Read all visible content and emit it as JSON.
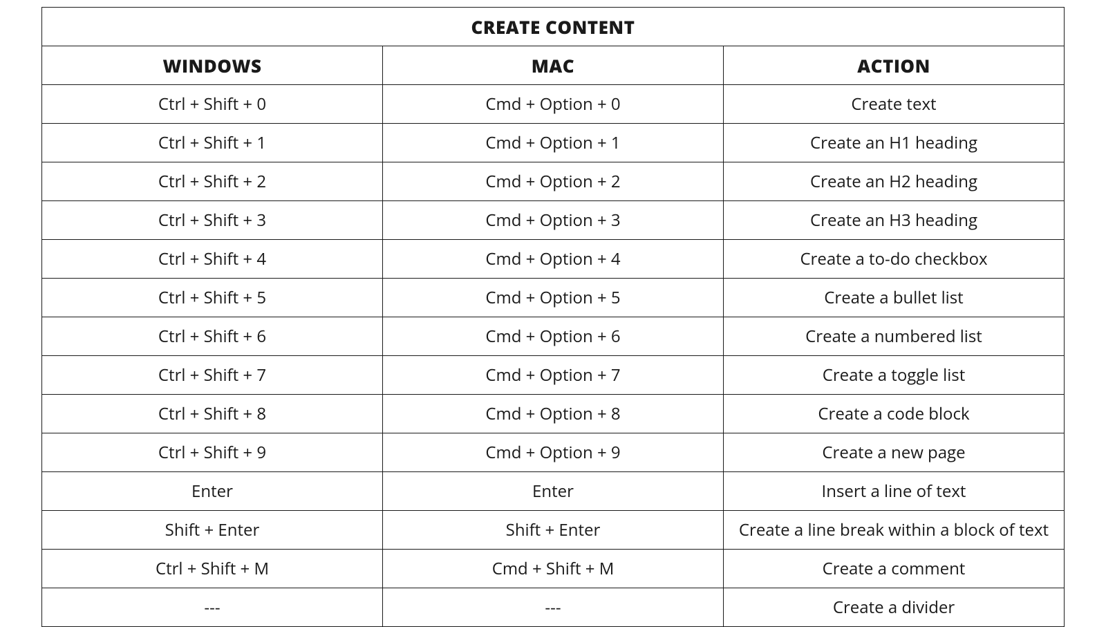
{
  "table": {
    "title": "CREATE CONTENT",
    "headers": {
      "windows": "WINDOWS",
      "mac": "MAC",
      "action": "ACTION"
    },
    "rows": [
      {
        "windows": "Ctrl + Shift + 0",
        "mac": "Cmd + Option + 0",
        "action": "Create text"
      },
      {
        "windows": "Ctrl + Shift + 1",
        "mac": "Cmd + Option + 1",
        "action": "Create an H1 heading"
      },
      {
        "windows": "Ctrl + Shift + 2",
        "mac": "Cmd + Option + 2",
        "action": "Create an H2 heading"
      },
      {
        "windows": "Ctrl + Shift + 3",
        "mac": "Cmd + Option + 3",
        "action": "Create an H3 heading"
      },
      {
        "windows": "Ctrl + Shift + 4",
        "mac": "Cmd + Option + 4",
        "action": "Create a to-do checkbox"
      },
      {
        "windows": "Ctrl + Shift + 5",
        "mac": "Cmd + Option + 5",
        "action": "Create a bullet list"
      },
      {
        "windows": "Ctrl + Shift + 6",
        "mac": "Cmd + Option + 6",
        "action": "Create a numbered list"
      },
      {
        "windows": "Ctrl + Shift + 7",
        "mac": "Cmd + Option + 7",
        "action": "Create a toggle list"
      },
      {
        "windows": "Ctrl + Shift + 8",
        "mac": "Cmd + Option + 8",
        "action": "Create a code block"
      },
      {
        "windows": "Ctrl + Shift + 9",
        "mac": "Cmd + Option + 9",
        "action": "Create a new page"
      },
      {
        "windows": "Enter",
        "mac": "Enter",
        "action": "Insert a line of text"
      },
      {
        "windows": "Shift + Enter",
        "mac": "Shift + Enter",
        "action": "Create a line break within a block of text"
      },
      {
        "windows": "Ctrl + Shift + M",
        "mac": "Cmd + Shift + M",
        "action": "Create a comment"
      },
      {
        "windows": "---",
        "mac": "---",
        "action": "Create a divider"
      }
    ]
  }
}
